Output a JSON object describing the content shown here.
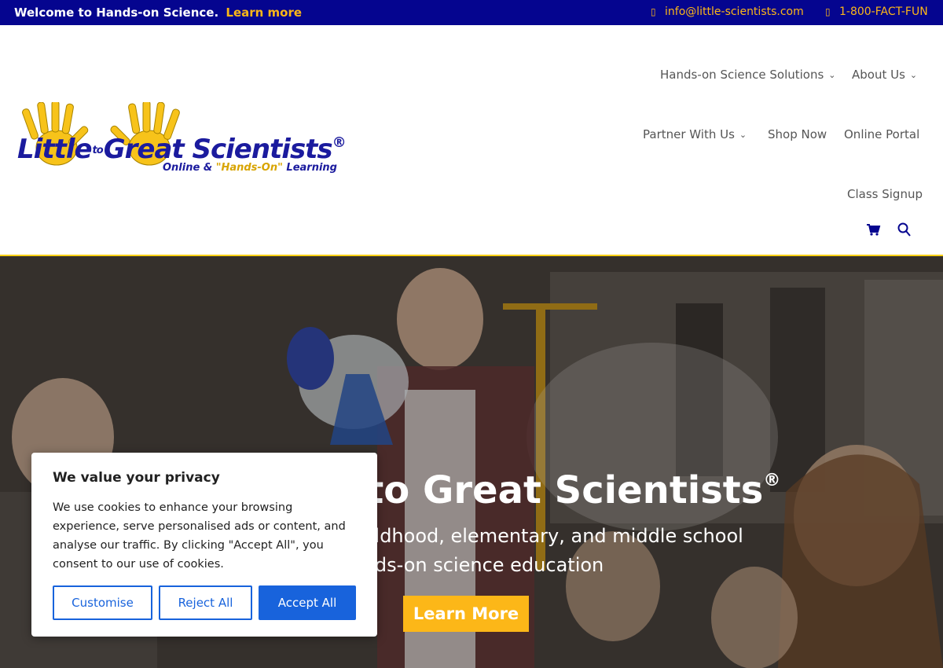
{
  "topbar": {
    "welcome": "Welcome to Hands-on Science.",
    "learn_more": "Learn more",
    "email": "info@little-scientists.com",
    "phone": "1-800-FACT-FUN",
    "email_icon": "envelope-icon",
    "phone_icon": "phone-icon"
  },
  "logo": {
    "part1": "Little",
    "part2": "to",
    "part3": "Great Scientists",
    "reg": "®",
    "tagline_a": "Online & ",
    "tagline_b": "\"Hands-On\"",
    "tagline_c": " Learning"
  },
  "nav": {
    "hands_on": "Hands-on Science Solutions",
    "about": "About Us",
    "partner": "Partner With Us",
    "shop": "Shop Now",
    "portal": "Online Portal",
    "signup": "Class Signup",
    "chevron": "⌄",
    "cart_icon": "cart-icon",
    "search_icon": "search-icon"
  },
  "hero": {
    "title": "Little to Great Scientists",
    "title_reg": "®",
    "subtitle": "Leader in early childhood, elementary, and middle school hands-on science education",
    "button": "Learn More"
  },
  "cookie": {
    "title": "We value your privacy",
    "body": "We use cookies to enhance your browsing experience, serve personalised ads or content, and analyse our traffic. By clicking \"Accept All\", you consent to our use of cookies.",
    "customise": "Customise",
    "reject": "Reject All",
    "accept": "Accept All"
  },
  "colors": {
    "topbar_bg": "#05058f",
    "accent_yellow": "#fcb718",
    "brand_blue": "#1b1b9e",
    "cookie_blue": "#1863dc"
  }
}
